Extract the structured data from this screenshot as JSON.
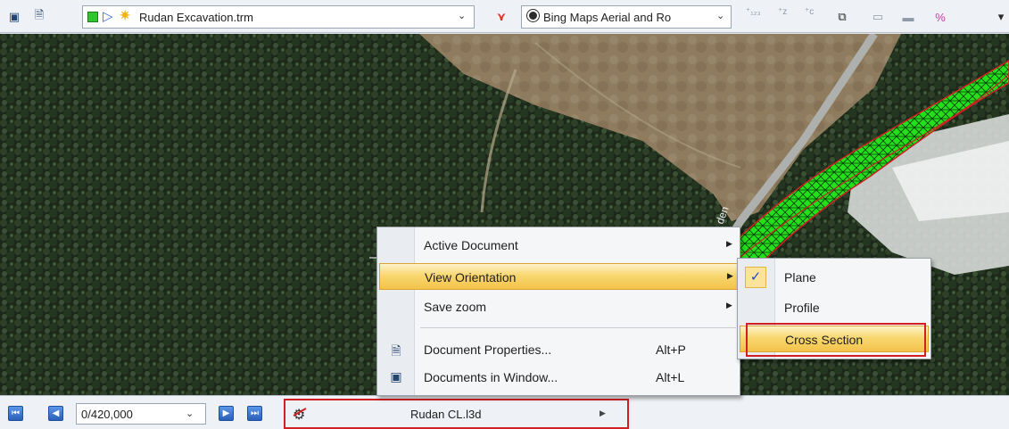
{
  "toolbar": {
    "document_name": "Rudan Excavation.trm",
    "map_source": "Bing Maps Aerial and Ro",
    "icons": [
      "documents-in-window-icon",
      "document-properties-icon",
      "green-square-icon",
      "triangle-icon",
      "sun-icon",
      "alignment-tool-icon",
      "globe-icon",
      "add-point-icon",
      "add-elevation-icon",
      "add-contour-icon",
      "window-layout-icon",
      "window-split-icon",
      "window-single-icon",
      "measure-icon"
    ]
  },
  "map": {
    "road_label": "den"
  },
  "context_menu": {
    "items": [
      {
        "label": "Active Document",
        "has_submenu": true
      },
      {
        "label": "View Orientation",
        "has_submenu": true,
        "highlighted": true
      },
      {
        "label": "Save zoom",
        "has_submenu": true
      },
      {
        "label": "Document Properties...",
        "shortcut": "Alt+P",
        "icon": "document-properties-icon"
      },
      {
        "label": "Documents in Window...",
        "shortcut": "Alt+L",
        "icon": "documents-in-window-icon"
      }
    ]
  },
  "submenu": {
    "items": [
      {
        "label": "Plane",
        "checked": true,
        "check_mark": "✓"
      },
      {
        "label": "Profile"
      },
      {
        "label": "Cross Section",
        "highlighted": true
      }
    ]
  },
  "bottombar": {
    "station": "0/420,000",
    "alignment": "Rudan CL.l3d"
  },
  "colors": {
    "highlight": "#f8d870",
    "annotation_red": "#d21f25",
    "corridor_green": "#22e01a"
  }
}
